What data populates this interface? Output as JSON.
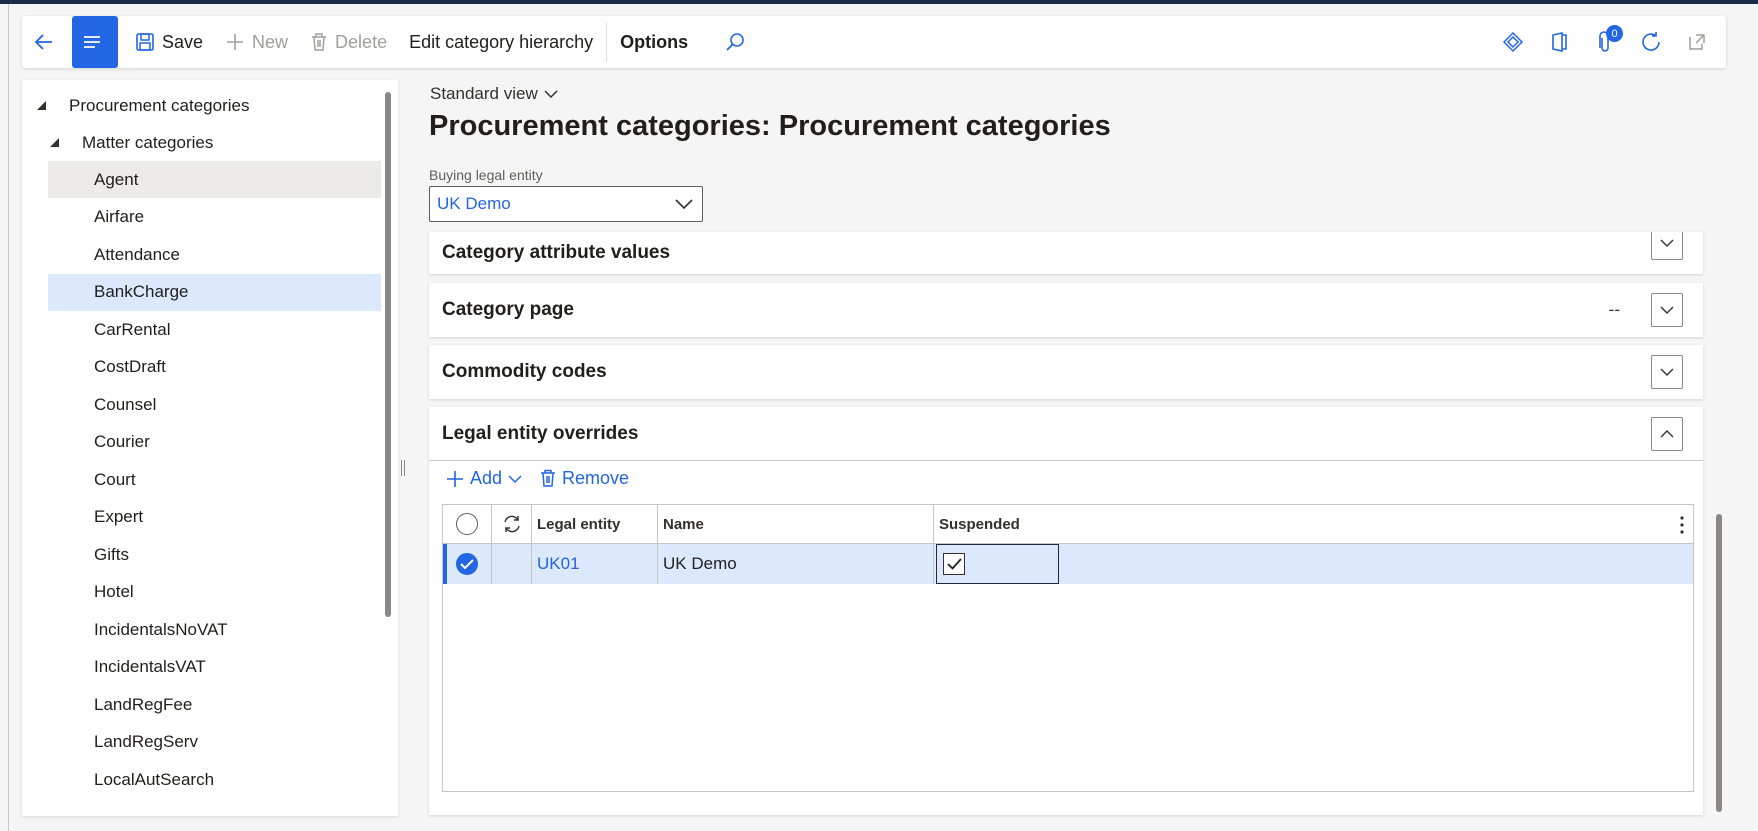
{
  "action_pane": {
    "save_label": "Save",
    "new_label": "New",
    "delete_label": "Delete",
    "edit_hierarchy_label": "Edit category hierarchy",
    "options_label": "Options",
    "notification_count": "0"
  },
  "tree": {
    "root": "Procurement categories",
    "group": "Matter categories",
    "items": [
      {
        "label": "Agent",
        "state": "hover"
      },
      {
        "label": "Airfare",
        "state": ""
      },
      {
        "label": "Attendance",
        "state": ""
      },
      {
        "label": "BankCharge",
        "state": "selected"
      },
      {
        "label": "CarRental",
        "state": ""
      },
      {
        "label": "CostDraft",
        "state": ""
      },
      {
        "label": "Counsel",
        "state": ""
      },
      {
        "label": "Courier",
        "state": ""
      },
      {
        "label": "Court",
        "state": ""
      },
      {
        "label": "Expert",
        "state": ""
      },
      {
        "label": "Gifts",
        "state": ""
      },
      {
        "label": "Hotel",
        "state": ""
      },
      {
        "label": "IncidentalsNoVAT",
        "state": ""
      },
      {
        "label": "IncidentalsVAT",
        "state": ""
      },
      {
        "label": "LandRegFee",
        "state": ""
      },
      {
        "label": "LandRegServ",
        "state": ""
      },
      {
        "label": "LocalAutSearch",
        "state": ""
      }
    ]
  },
  "main": {
    "view_name": "Standard view",
    "title": "Procurement categories: Procurement categories",
    "buying_legal_entity_label": "Buying legal entity",
    "buying_legal_entity_value": "UK Demo",
    "fasttabs": {
      "attribute_values": "Category attribute values",
      "category_page": "Category page",
      "category_page_summary": "--",
      "commodity_codes": "Commodity codes",
      "legal_entity_overrides": "Legal entity overrides"
    },
    "grid_toolbar": {
      "add_label": "Add",
      "remove_label": "Remove"
    },
    "grid": {
      "columns": [
        "Legal entity",
        "Name",
        "Suspended"
      ],
      "rows": [
        {
          "legal_entity": "UK01",
          "name": "UK Demo",
          "suspended": true
        }
      ]
    }
  },
  "colors": {
    "accent": "#2266e3",
    "selected_row": "#dce8fb",
    "top_bar": "#1b2a47"
  }
}
